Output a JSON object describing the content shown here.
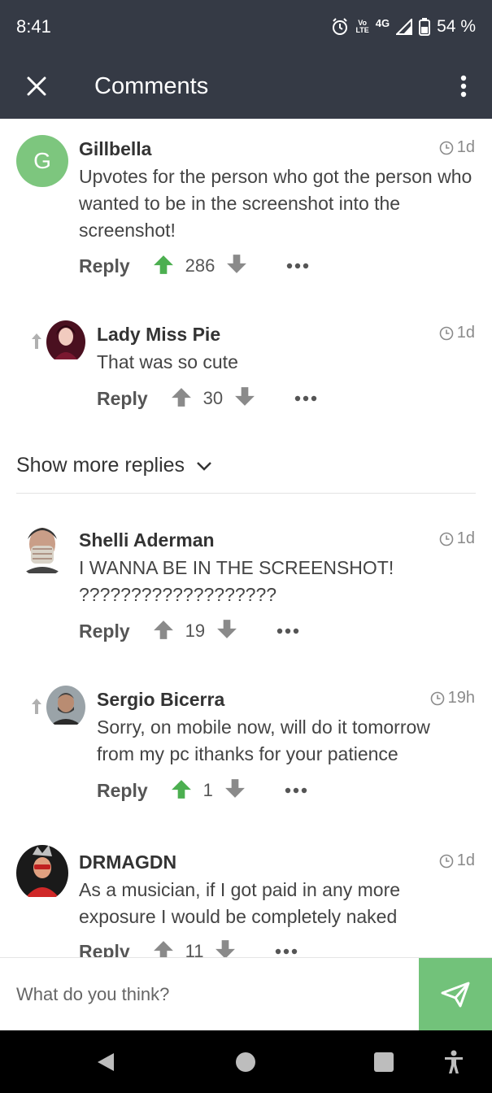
{
  "status_bar": {
    "time": "8:41",
    "volte_top": "Vo",
    "volte_bottom": "LTE",
    "network": "4G",
    "battery": "54 %"
  },
  "app_bar": {
    "title": "Comments"
  },
  "colors": {
    "header": "#353a45",
    "accent": "#72c27a",
    "upvote_active": "#4caf50",
    "vote_inactive": "#8a8a8a"
  },
  "comments": [
    {
      "author": "Gillbella",
      "avatar_letter": "G",
      "time": "1d",
      "text": "Upvotes for the person who got the person who wanted to be in the screenshot into the screenshot!",
      "reply_label": "Reply",
      "votes": "286",
      "upvoted": true
    },
    {
      "author": "Lady Miss Pie",
      "time": "1d",
      "text": "That was so cute",
      "reply_label": "Reply",
      "votes": "30",
      "upvoted": false
    },
    {
      "author": "Shelli Aderman",
      "time": "1d",
      "text": "I WANNA BE IN THE SCREENSHOT! ???????????????????",
      "reply_label": "Reply",
      "votes": "19",
      "upvoted": false
    },
    {
      "author": "Sergio Bicerra",
      "time": "19h",
      "text": "Sorry, on mobile now, will do it tomorrow from my pc ithanks for your patience",
      "reply_label": "Reply",
      "votes": "1",
      "upvoted": true
    },
    {
      "author": "DRMAGDN",
      "time": "1d",
      "text": "As a musician, if I got paid in any more exposure I would be completely naked",
      "reply_label": "Reply",
      "votes": "11",
      "upvoted": false
    }
  ],
  "show_more": "Show more replies",
  "input": {
    "placeholder": "What do you think?"
  }
}
